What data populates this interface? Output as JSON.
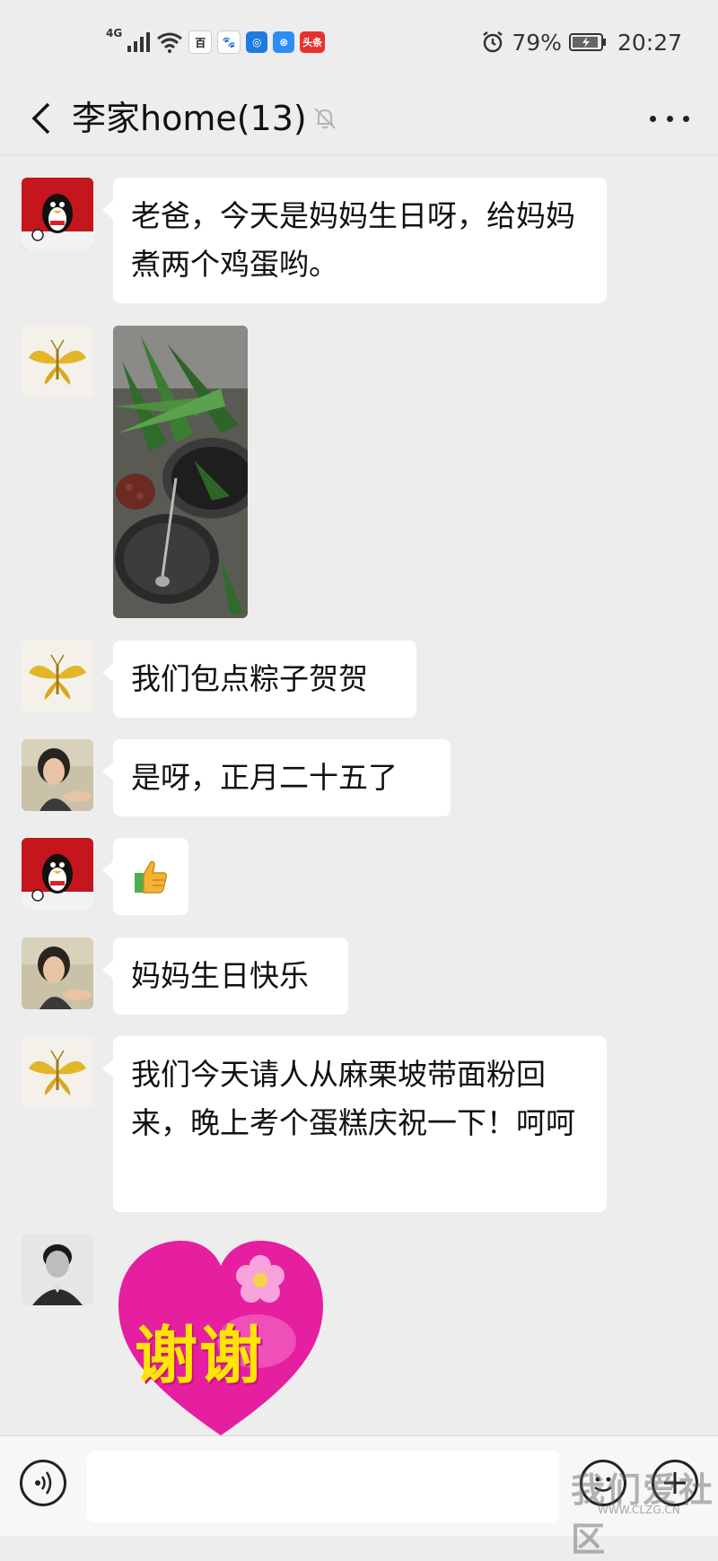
{
  "status_bar": {
    "network": "4G",
    "apps": [
      {
        "name": "baidu-zhidao-icon",
        "text": "百",
        "color": "#2f6fde"
      },
      {
        "name": "baidu-paw-icon",
        "text": "🐾",
        "color": "#2f5bd8"
      },
      {
        "name": "app-blue-icon",
        "text": "◎",
        "color": "#1f7ae0"
      },
      {
        "name": "app-ring-icon",
        "text": "⊗",
        "color": "#2c8df5"
      },
      {
        "name": "toutiao-icon",
        "text": "头条",
        "color": "#e8312e"
      }
    ],
    "battery": "79%",
    "time": "20:27"
  },
  "header": {
    "title": "李家home(13)"
  },
  "messages": [
    {
      "type": "text",
      "avatar": "penguin-avatar",
      "text": "老爸，今天是妈妈生日呀，给妈妈煮两个鸡蛋哟。"
    },
    {
      "type": "image",
      "avatar": "butterfly-avatar",
      "alt": "zongzi leaves photo"
    },
    {
      "type": "text",
      "avatar": "butterfly-avatar",
      "text": "我们包点粽子贺贺"
    },
    {
      "type": "text",
      "avatar": "woman-avatar",
      "text": "是呀，正月二十五了"
    },
    {
      "type": "emoji",
      "avatar": "penguin-avatar",
      "text": "👍"
    },
    {
      "type": "text",
      "avatar": "woman-avatar",
      "text": "妈妈生日快乐"
    },
    {
      "type": "text",
      "avatar": "butterfly-avatar",
      "text": "我们今天请人从麻栗坡带面粉回来，晚上考个蛋糕庆祝一下！呵呵"
    },
    {
      "type": "sticker",
      "avatar": "man-avatar",
      "text": "谢谢"
    }
  ],
  "input_bar": {
    "watermark": "我们爱社区",
    "watermark_sub": "WWW.CLZG.CN"
  }
}
